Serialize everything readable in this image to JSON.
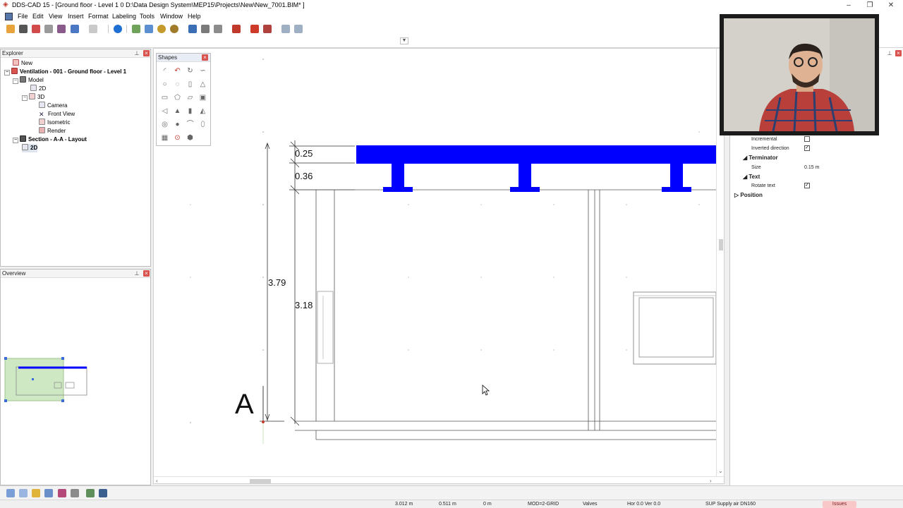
{
  "window": {
    "title": "DDS-CAD 15 - [Ground floor - Level 1  0  D:\\Data Design System\\MEP15\\Projects\\New\\New_7001.BIM* ]",
    "minimize": "–",
    "restore": "❐",
    "close": "✕"
  },
  "menu": [
    "File",
    "Edit",
    "View",
    "Insert",
    "Format",
    "Labeling",
    "Tools",
    "Window",
    "Help"
  ],
  "explorer": {
    "title": "Explorer",
    "items": [
      {
        "label": "New",
        "bold": false
      },
      {
        "label": "Ventilation - 001 - Ground floor - Level 1",
        "bold": true
      },
      {
        "label": "Model",
        "bold": false
      },
      {
        "label": "2D",
        "bold": false
      },
      {
        "label": "3D",
        "bold": false
      },
      {
        "label": "Camera",
        "bold": false
      },
      {
        "label": "Front View",
        "bold": false
      },
      {
        "label": "Isometric",
        "bold": false
      },
      {
        "label": "Render",
        "bold": false
      },
      {
        "label": "Section - A-A - Layout",
        "bold": true
      },
      {
        "label": "2D",
        "bold": true
      }
    ]
  },
  "overview": {
    "title": "Overview"
  },
  "shapes": {
    "title": "Shapes"
  },
  "drawing": {
    "dimensions": [
      "0.25",
      "0.36",
      "3.79",
      "3.18"
    ],
    "section_label": "A",
    "accent_color": "#0000ff"
  },
  "properties": {
    "incremental_label": "Incremental",
    "incremental_checked": false,
    "inverted_direction_label": "Inverted direction",
    "inverted_direction_checked": true,
    "terminator_group": "Terminator",
    "size_label": "Size",
    "size_value": "0.15 m",
    "text_group": "Text",
    "rotate_text_label": "Rotate text",
    "rotate_text_checked": true,
    "position_group": "Position"
  },
  "status": {
    "x": "3.012 m",
    "y": "0.511 m",
    "z": "0 m",
    "mode": "MOD=2-GRID",
    "layer": "Valves",
    "angles": "Hor  0.0 Ver  0.0",
    "system": "SUP Supply air DN160",
    "issues": "Issues"
  }
}
